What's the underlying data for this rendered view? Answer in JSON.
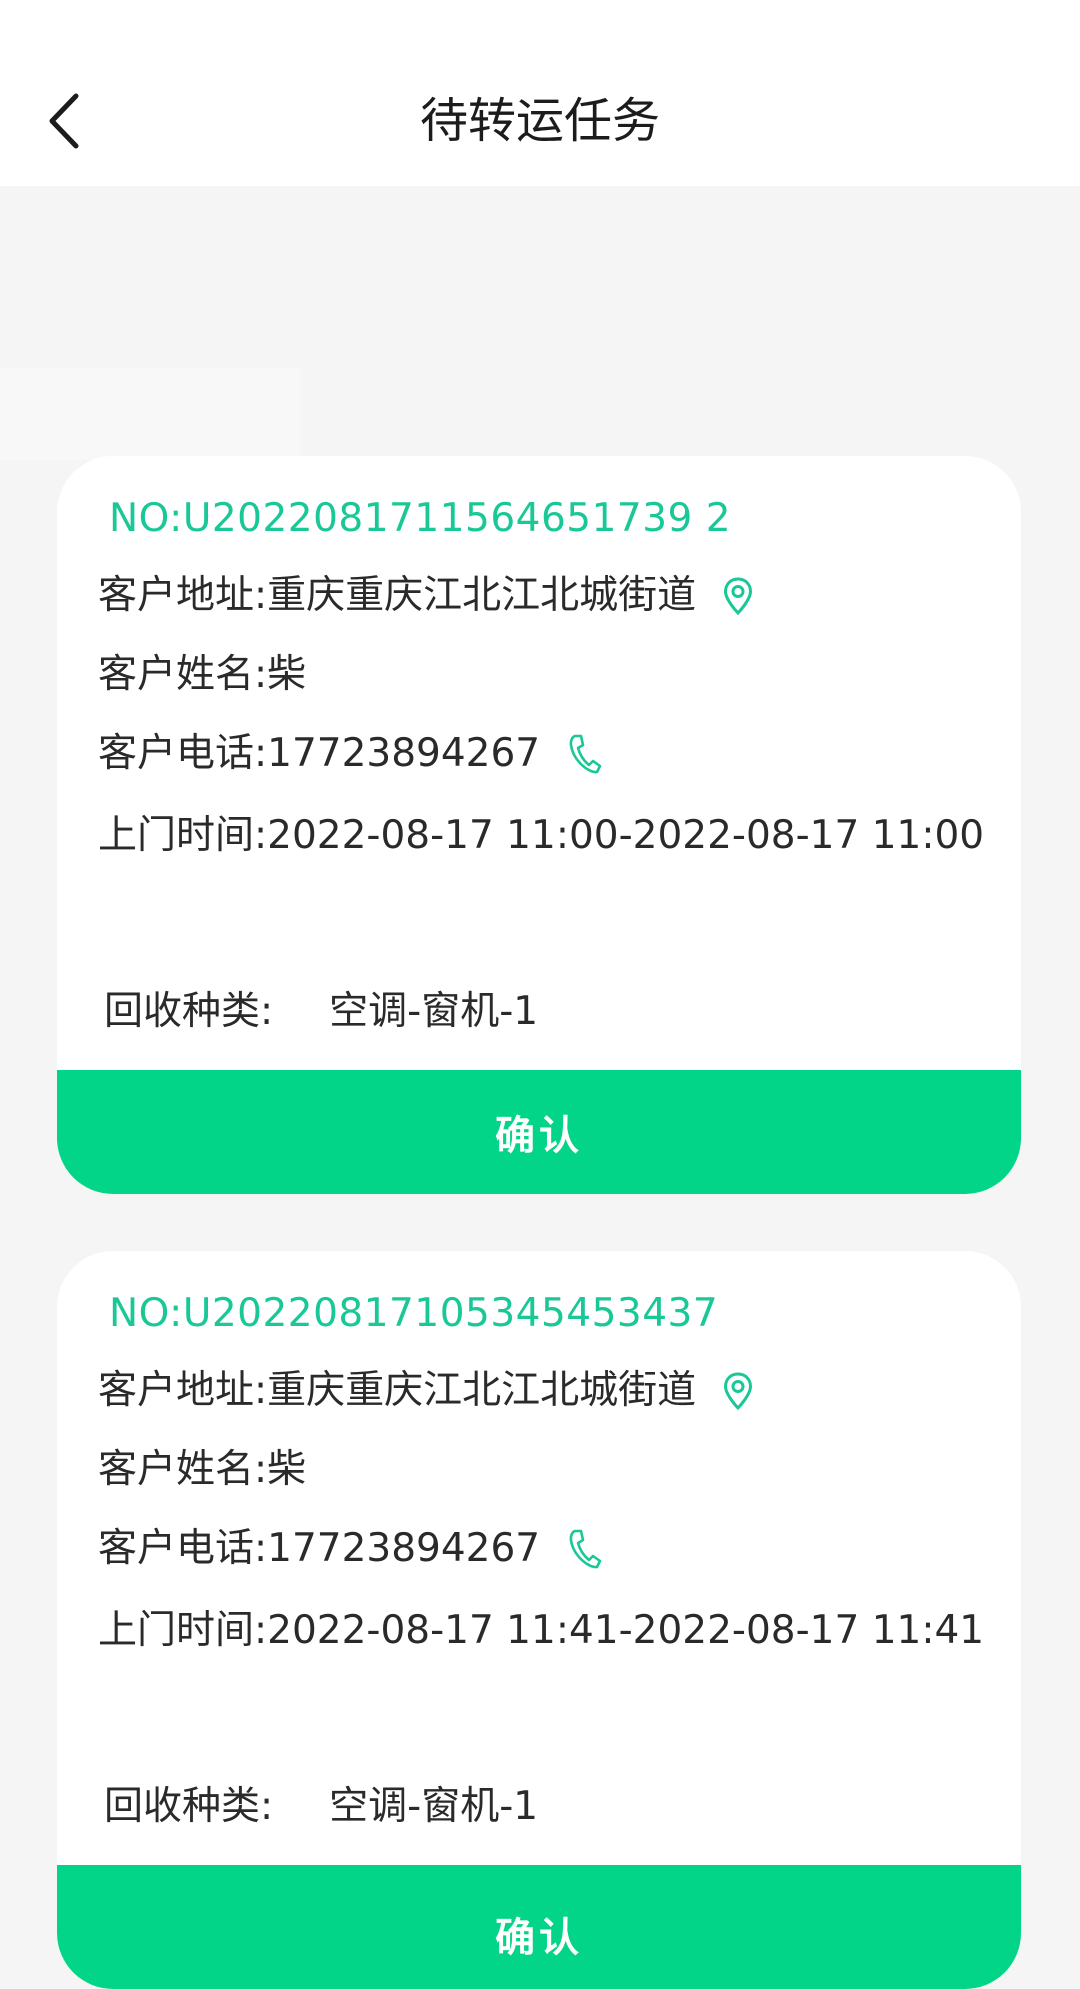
{
  "header": {
    "title": "待转运任务"
  },
  "labels": {
    "address": "客户地址:",
    "name": "客户姓名:",
    "phone": "客户电话:",
    "visit_time": "上门时间:",
    "category": "回收种类:",
    "confirm": "确认"
  },
  "accent_color": "#19c896",
  "button_color": "#02d587",
  "tasks": [
    {
      "order_no": "NO:U2022081711564651739 2",
      "address": "重庆重庆江北江北城街道",
      "name": "柴",
      "phone": "17723894267",
      "visit_time": "2022-08-17 11:00-2022-08-17 11:00",
      "category": "空调-窗机-1"
    },
    {
      "order_no": "NO:U20220817105345453437",
      "address": "重庆重庆江北江北城街道",
      "name": "柴",
      "phone": "17723894267",
      "visit_time": "2022-08-17 11:41-2022-08-17 11:41",
      "category": "空调-窗机-1"
    }
  ]
}
